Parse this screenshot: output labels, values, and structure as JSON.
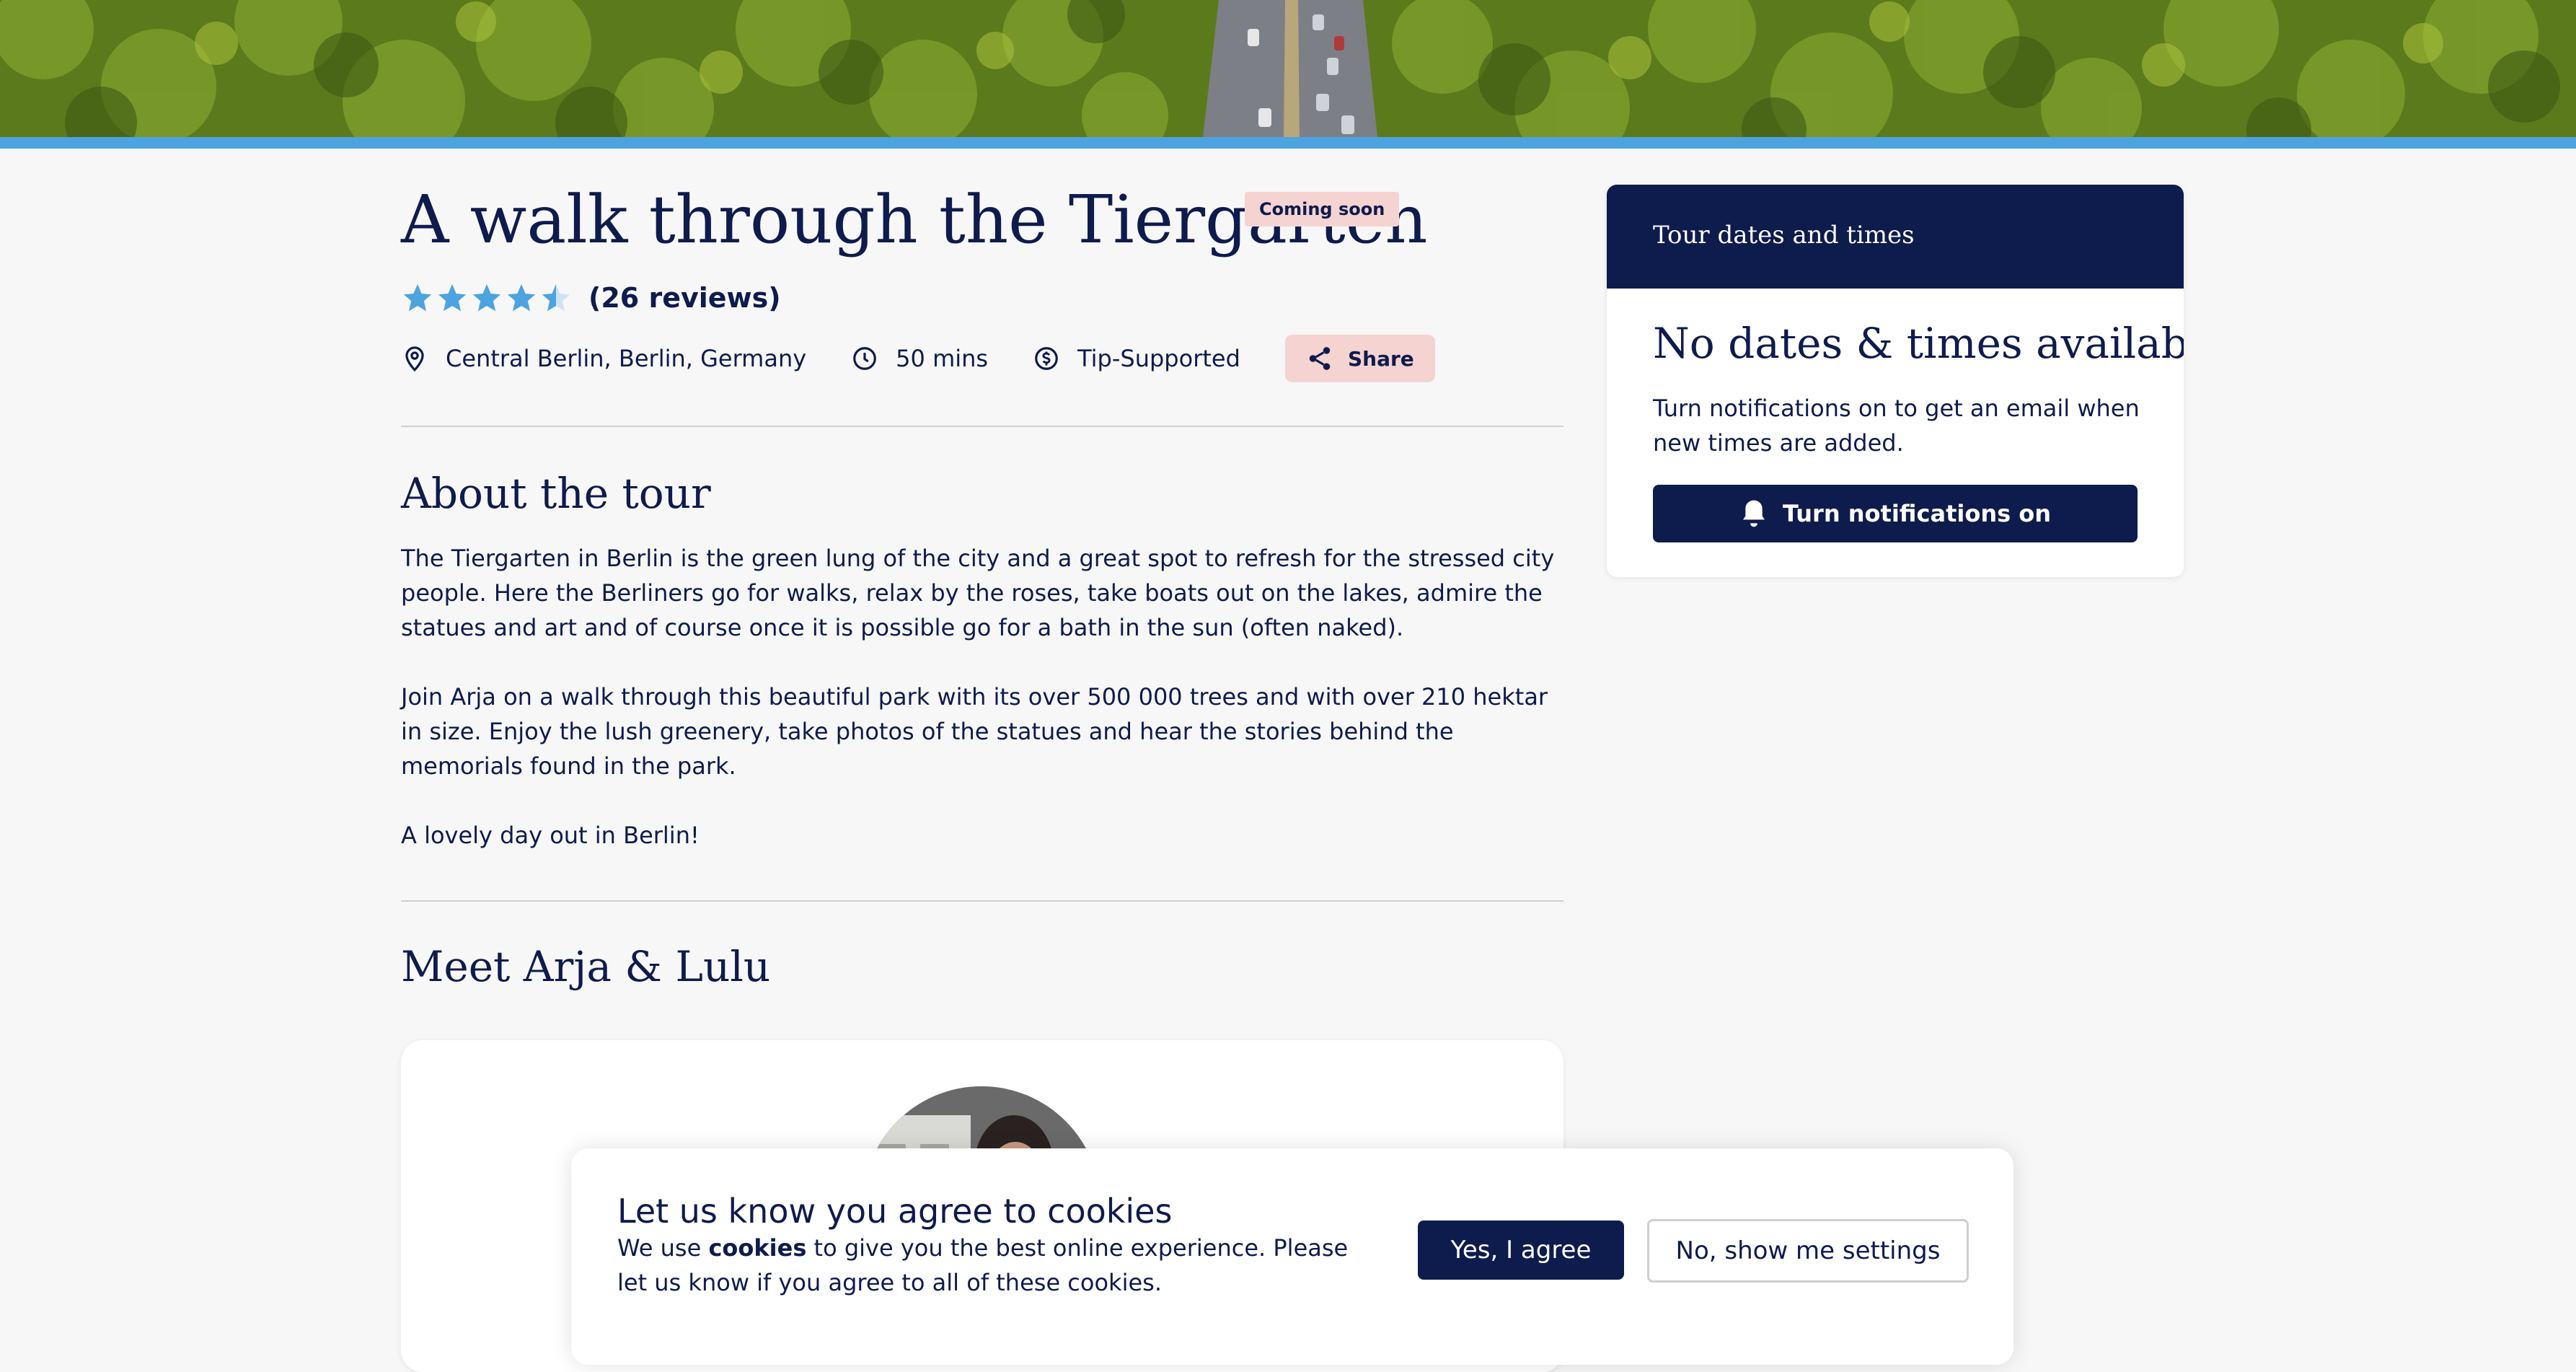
{
  "tour": {
    "title": "A walk through the Tiergarten",
    "badge": "Coming soon",
    "rating_value": 4.5,
    "rating_max": 5,
    "reviews": "(26 reviews)",
    "location": "Central Berlin, Berlin, Germany",
    "duration": "50 mins",
    "price_type": "Tip-Supported",
    "share_label": "Share"
  },
  "about": {
    "heading": "About the tour",
    "paragraph_1": "The Tiergarten in Berlin is the green lung of the city and a great spot to refresh for the stressed city people. Here the Berliners go for walks, relax by the roses, take boats out on the lakes, admire the statues and art and of course once it is possible go for a bath in the sun (often naked).",
    "paragraph_2": "Join Arja on a walk through this beautiful park with its over 500 000 trees and with over 210 hektar in size. Enjoy the lush greenery, take photos of the statues and hear the stories behind the memorials found in the park.",
    "paragraph_3": "A lovely day out in Berlin!"
  },
  "hosts": {
    "heading": "Meet Arja & Lulu"
  },
  "sidebar": {
    "header": "Tour dates and times",
    "title": "No dates & times available",
    "text": "Turn notifications on to get an email when new times are added.",
    "button": "Turn notifications on"
  },
  "cookies": {
    "title": "Let us know you agree to cookies",
    "text_before": "We use ",
    "text_bold": "cookies",
    "text_after": " to give you the best online experience. Please let us know if you agree to all of these cookies.",
    "agree": "Yes, I agree",
    "settings": "No, show me settings"
  },
  "icons": {
    "location": "map-pin-icon",
    "duration": "clock-icon",
    "price": "dollar-coin-icon",
    "share": "share-icon",
    "notifications": "bell-icon",
    "rating": "star-icon"
  },
  "colors": {
    "primary": "#0e1b4d",
    "accent_bar": "#4da3df",
    "star": "#4da3df",
    "badge_bg": "#f5d3d1",
    "share_bg": "#f5d3d1",
    "page_bg": "#f7f7f7"
  }
}
